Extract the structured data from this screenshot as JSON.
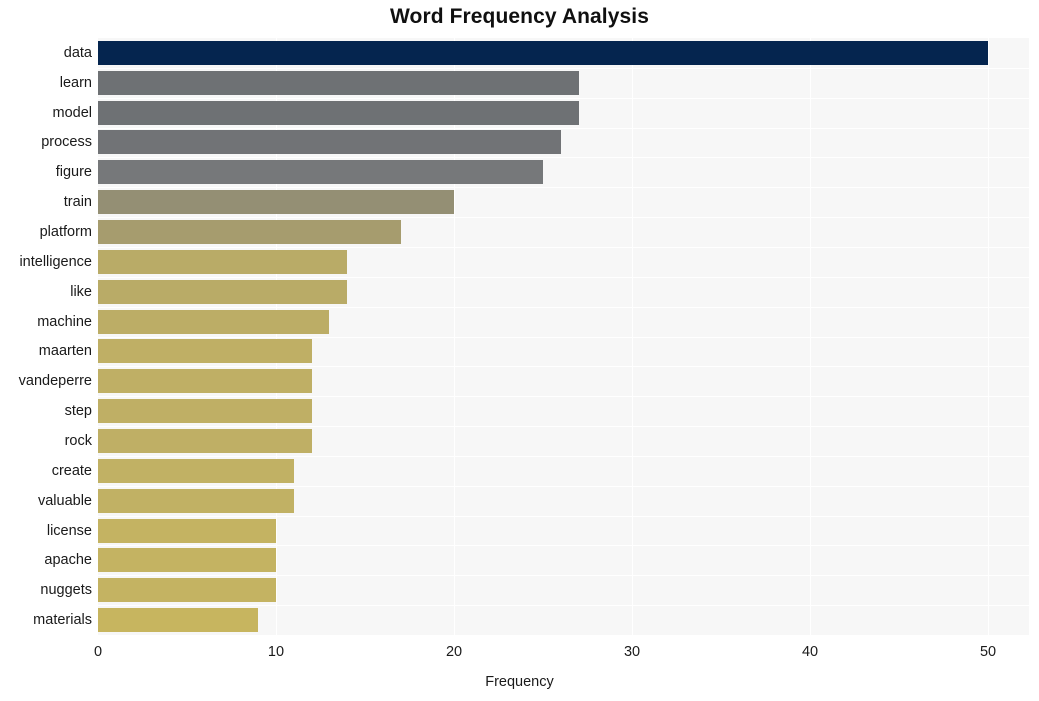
{
  "chart_data": {
    "type": "bar",
    "orientation": "horizontal",
    "title": "Word Frequency Analysis",
    "xlabel": "Frequency",
    "ylabel": "",
    "xlim": [
      0,
      52.3
    ],
    "xticks": [
      0,
      10,
      20,
      30,
      40,
      50
    ],
    "xticklabels": [
      "0",
      "10",
      "20",
      "30",
      "40",
      "50"
    ],
    "grid": true,
    "legend": false,
    "categories": [
      "data",
      "learn",
      "model",
      "process",
      "figure",
      "train",
      "platform",
      "intelligence",
      "like",
      "machine",
      "maarten",
      "vandeperre",
      "step",
      "rock",
      "create",
      "valuable",
      "license",
      "apache",
      "nuggets",
      "materials"
    ],
    "values": [
      50,
      27,
      27,
      26,
      25,
      20,
      17,
      14,
      14,
      13,
      12,
      12,
      12,
      12,
      11,
      11,
      10,
      10,
      10,
      9
    ],
    "bar_colors": [
      "#05254f",
      "#6e7174",
      "#6e7174",
      "#717376",
      "#76787a",
      "#948f74",
      "#a69c6e",
      "#b9ab67",
      "#b9ab67",
      "#bcad66",
      "#bfaf65",
      "#bfaf65",
      "#bfaf65",
      "#bfaf65",
      "#c1b164",
      "#c1b164",
      "#c4b362",
      "#c4b362",
      "#c4b362",
      "#c7b55f"
    ],
    "plot_background": "#f7f7f7",
    "figure_background": "#ffffff",
    "grid_color": "#ffffff"
  }
}
